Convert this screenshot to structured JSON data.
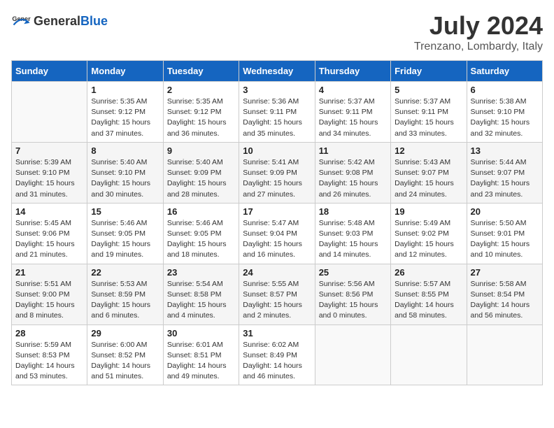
{
  "header": {
    "logo_general": "General",
    "logo_blue": "Blue",
    "month_year": "July 2024",
    "location": "Trenzano, Lombardy, Italy"
  },
  "columns": [
    "Sunday",
    "Monday",
    "Tuesday",
    "Wednesday",
    "Thursday",
    "Friday",
    "Saturday"
  ],
  "weeks": [
    [
      {
        "day": "",
        "info": ""
      },
      {
        "day": "1",
        "info": "Sunrise: 5:35 AM\nSunset: 9:12 PM\nDaylight: 15 hours\nand 37 minutes."
      },
      {
        "day": "2",
        "info": "Sunrise: 5:35 AM\nSunset: 9:12 PM\nDaylight: 15 hours\nand 36 minutes."
      },
      {
        "day": "3",
        "info": "Sunrise: 5:36 AM\nSunset: 9:11 PM\nDaylight: 15 hours\nand 35 minutes."
      },
      {
        "day": "4",
        "info": "Sunrise: 5:37 AM\nSunset: 9:11 PM\nDaylight: 15 hours\nand 34 minutes."
      },
      {
        "day": "5",
        "info": "Sunrise: 5:37 AM\nSunset: 9:11 PM\nDaylight: 15 hours\nand 33 minutes."
      },
      {
        "day": "6",
        "info": "Sunrise: 5:38 AM\nSunset: 9:10 PM\nDaylight: 15 hours\nand 32 minutes."
      }
    ],
    [
      {
        "day": "7",
        "info": "Sunrise: 5:39 AM\nSunset: 9:10 PM\nDaylight: 15 hours\nand 31 minutes."
      },
      {
        "day": "8",
        "info": "Sunrise: 5:40 AM\nSunset: 9:10 PM\nDaylight: 15 hours\nand 30 minutes."
      },
      {
        "day": "9",
        "info": "Sunrise: 5:40 AM\nSunset: 9:09 PM\nDaylight: 15 hours\nand 28 minutes."
      },
      {
        "day": "10",
        "info": "Sunrise: 5:41 AM\nSunset: 9:09 PM\nDaylight: 15 hours\nand 27 minutes."
      },
      {
        "day": "11",
        "info": "Sunrise: 5:42 AM\nSunset: 9:08 PM\nDaylight: 15 hours\nand 26 minutes."
      },
      {
        "day": "12",
        "info": "Sunrise: 5:43 AM\nSunset: 9:07 PM\nDaylight: 15 hours\nand 24 minutes."
      },
      {
        "day": "13",
        "info": "Sunrise: 5:44 AM\nSunset: 9:07 PM\nDaylight: 15 hours\nand 23 minutes."
      }
    ],
    [
      {
        "day": "14",
        "info": "Sunrise: 5:45 AM\nSunset: 9:06 PM\nDaylight: 15 hours\nand 21 minutes."
      },
      {
        "day": "15",
        "info": "Sunrise: 5:46 AM\nSunset: 9:05 PM\nDaylight: 15 hours\nand 19 minutes."
      },
      {
        "day": "16",
        "info": "Sunrise: 5:46 AM\nSunset: 9:05 PM\nDaylight: 15 hours\nand 18 minutes."
      },
      {
        "day": "17",
        "info": "Sunrise: 5:47 AM\nSunset: 9:04 PM\nDaylight: 15 hours\nand 16 minutes."
      },
      {
        "day": "18",
        "info": "Sunrise: 5:48 AM\nSunset: 9:03 PM\nDaylight: 15 hours\nand 14 minutes."
      },
      {
        "day": "19",
        "info": "Sunrise: 5:49 AM\nSunset: 9:02 PM\nDaylight: 15 hours\nand 12 minutes."
      },
      {
        "day": "20",
        "info": "Sunrise: 5:50 AM\nSunset: 9:01 PM\nDaylight: 15 hours\nand 10 minutes."
      }
    ],
    [
      {
        "day": "21",
        "info": "Sunrise: 5:51 AM\nSunset: 9:00 PM\nDaylight: 15 hours\nand 8 minutes."
      },
      {
        "day": "22",
        "info": "Sunrise: 5:53 AM\nSunset: 8:59 PM\nDaylight: 15 hours\nand 6 minutes."
      },
      {
        "day": "23",
        "info": "Sunrise: 5:54 AM\nSunset: 8:58 PM\nDaylight: 15 hours\nand 4 minutes."
      },
      {
        "day": "24",
        "info": "Sunrise: 5:55 AM\nSunset: 8:57 PM\nDaylight: 15 hours\nand 2 minutes."
      },
      {
        "day": "25",
        "info": "Sunrise: 5:56 AM\nSunset: 8:56 PM\nDaylight: 15 hours\nand 0 minutes."
      },
      {
        "day": "26",
        "info": "Sunrise: 5:57 AM\nSunset: 8:55 PM\nDaylight: 14 hours\nand 58 minutes."
      },
      {
        "day": "27",
        "info": "Sunrise: 5:58 AM\nSunset: 8:54 PM\nDaylight: 14 hours\nand 56 minutes."
      }
    ],
    [
      {
        "day": "28",
        "info": "Sunrise: 5:59 AM\nSunset: 8:53 PM\nDaylight: 14 hours\nand 53 minutes."
      },
      {
        "day": "29",
        "info": "Sunrise: 6:00 AM\nSunset: 8:52 PM\nDaylight: 14 hours\nand 51 minutes."
      },
      {
        "day": "30",
        "info": "Sunrise: 6:01 AM\nSunset: 8:51 PM\nDaylight: 14 hours\nand 49 minutes."
      },
      {
        "day": "31",
        "info": "Sunrise: 6:02 AM\nSunset: 8:49 PM\nDaylight: 14 hours\nand 46 minutes."
      },
      {
        "day": "",
        "info": ""
      },
      {
        "day": "",
        "info": ""
      },
      {
        "day": "",
        "info": ""
      }
    ]
  ]
}
